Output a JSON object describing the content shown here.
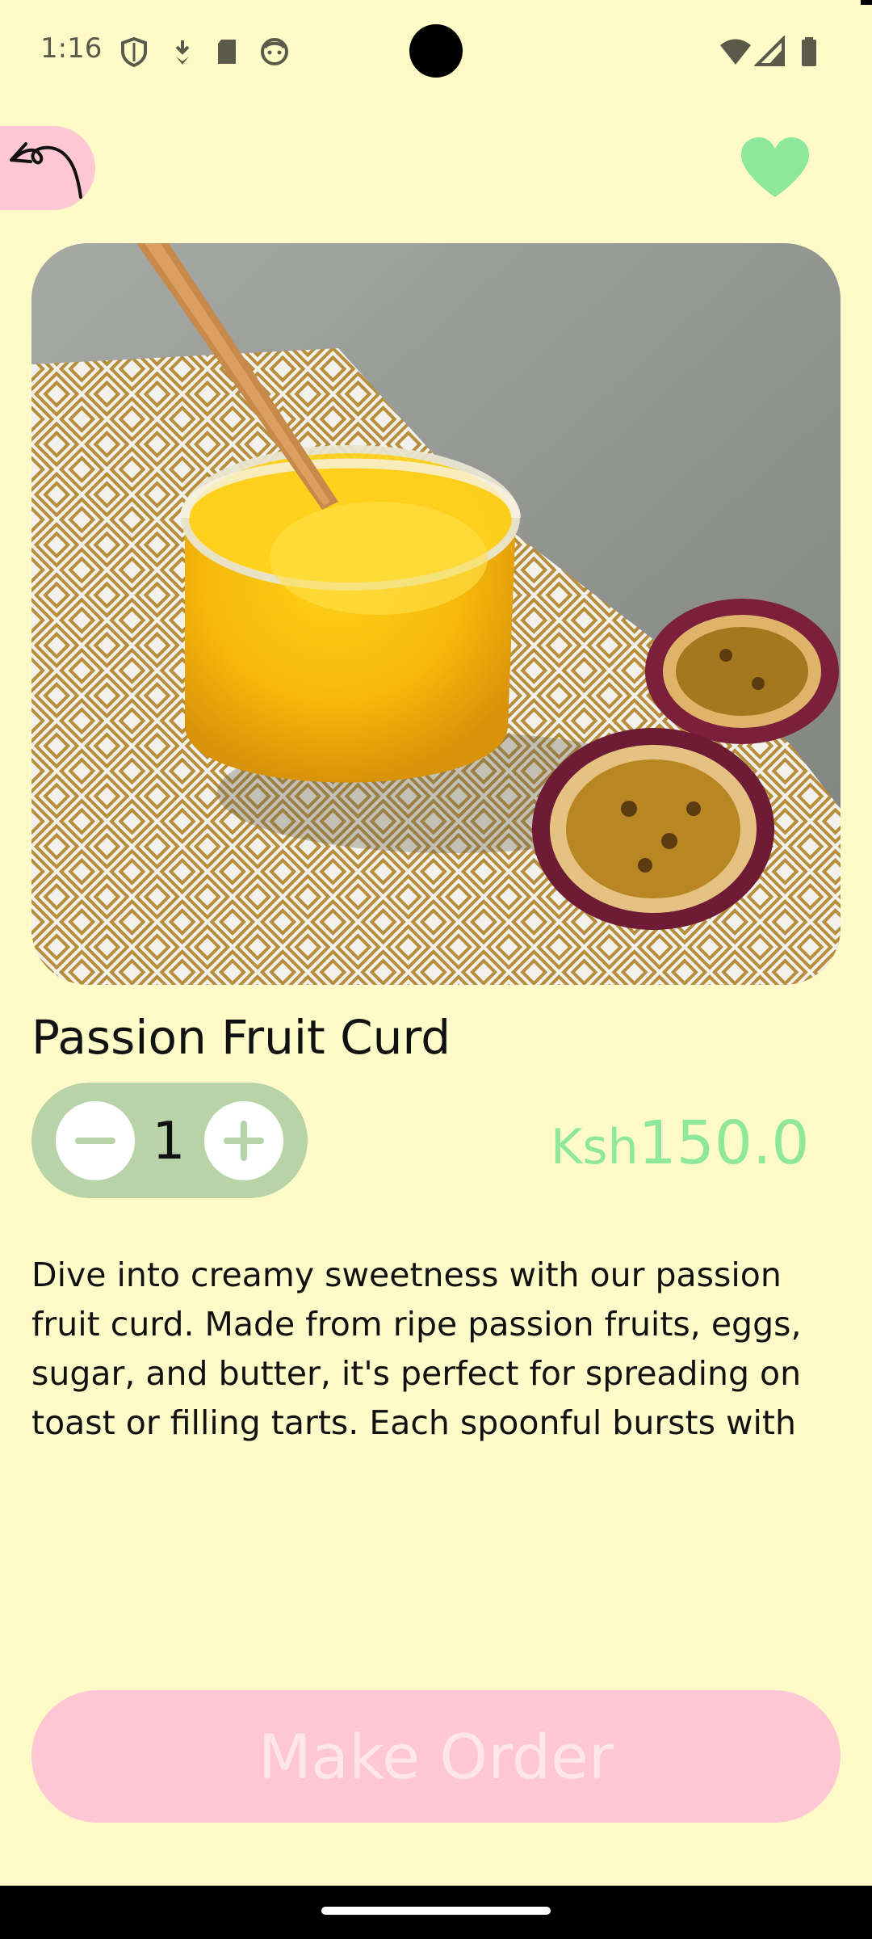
{
  "status_bar": {
    "time": "1:16",
    "icons": [
      "shield-icon",
      "download-icon",
      "sd-card-icon",
      "face-icon",
      "wifi-icon",
      "signal-icon",
      "battery-icon"
    ]
  },
  "header": {
    "back_icon": "back-arrow-icon",
    "favorite_icon": "heart-icon",
    "favorite_color": "#8ee89c",
    "back_bg_color": "#ffc7d3"
  },
  "product": {
    "image_description": "jar of passion fruit curd with spoon and halved passion fruits",
    "title": "Passion Fruit Curd",
    "quantity": "1",
    "price_currency": "Ksh",
    "price_amount": "150.0",
    "description": "Dive into creamy sweetness with our passion fruit curd. Made from ripe passion fruits, eggs, sugar, and butter, it's perfect for spreading on toast or filling tarts. Each spoonful bursts with tropical"
  },
  "order": {
    "button_label": "Make Order"
  },
  "colors": {
    "background": "#fffbc8",
    "stepper": "#b8d3a8",
    "price": "#8ee89c",
    "button": "#ffc7d3"
  }
}
